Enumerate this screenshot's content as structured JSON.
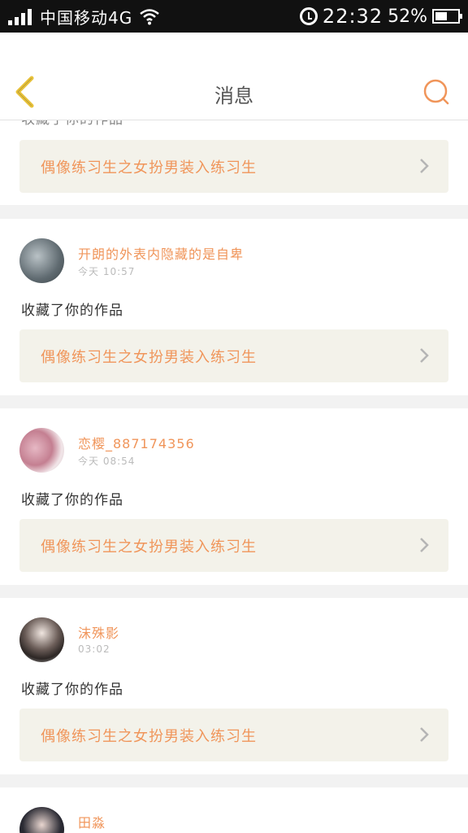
{
  "status_bar": {
    "carrier": "中国移动4G",
    "time": "22:32",
    "battery_percent": "52%",
    "battery_level": 0.52
  },
  "header": {
    "title": "消息",
    "back_icon": "chevron-left-icon",
    "search_icon": "search-icon"
  },
  "colors": {
    "accent": "#f0955a",
    "back_arrow": "#e8c23a",
    "link_bg": "#f3f2ea"
  },
  "partial_item": {
    "action": "收藏了你的作品",
    "work_title": "偶像练习生之女扮男装入练习生"
  },
  "messages": [
    {
      "username": "开朗的外表内隐藏的是自卑",
      "time": "今天 10:57",
      "action": "收藏了你的作品",
      "work_title": "偶像练习生之女扮男装入练习生"
    },
    {
      "username": "恋樱_887174356",
      "time": "今天 08:54",
      "action": "收藏了你的作品",
      "work_title": "偶像练习生之女扮男装入练习生"
    },
    {
      "username": "沫殊影",
      "time": "03:02",
      "action": "收藏了你的作品",
      "work_title": "偶像练习生之女扮男装入练习生"
    },
    {
      "username": "田淼"
    }
  ]
}
